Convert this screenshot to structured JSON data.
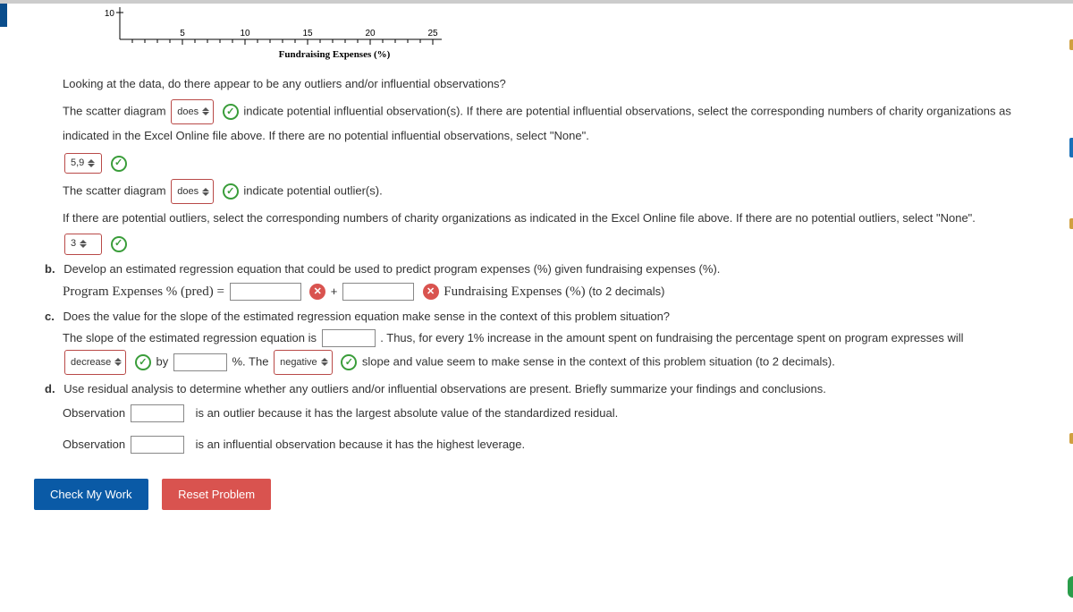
{
  "chart_data": {
    "type": "scatter",
    "xlabel": "Fundraising Expenses (%)",
    "x_ticks": [
      5,
      10,
      15,
      20,
      25
    ],
    "y_tick_visible": 10,
    "xlim": [
      2,
      27
    ]
  },
  "a": {
    "q_outliers": "Looking at the data, do there appear to be any outliers and/or influential observations?",
    "p1_pre": "The scatter diagram",
    "sel_does1": "does",
    "p1_post": "indicate potential influential observation(s). If there are potential influential observations, select the corresponding numbers of charity organizations as indicated in the Excel Online file above. If there are no potential influential observations, select \"None\".",
    "influential_sel": "5,9",
    "p2_pre": "The scatter diagram",
    "sel_does2": "does",
    "p2_post": "indicate potential outlier(s).",
    "p3": "If there are potential outliers, select the corresponding numbers of charity organizations as indicated in the Excel Online file above. If there are no potential outliers, select \"None\".",
    "outlier_sel": "3"
  },
  "b": {
    "label": "b.",
    "prompt": "Develop an estimated regression equation that could be used to predict program expenses (%) given fundraising expenses (%).",
    "lhs": "Program Expenses % (pred) =",
    "plus": "+",
    "rhs_label": "Fundraising Expenses (%)",
    "decimals": "(to 2 decimals)"
  },
  "c": {
    "label": "c.",
    "prompt": "Does the value for the slope of the estimated regression equation make sense in the context of this problem situation?",
    "p1_a": "The slope of the estimated regression equation is",
    "p1_b": ". Thus, for every 1% increase in the amount spent on fundraising the percentage spent on program expresses will",
    "sel_decrease": "decrease",
    "by_word": "by",
    "pct_the": "%. The",
    "sel_negative": "negative",
    "p1_end": "slope and value seem to make sense in the context of this problem situation (to 2 decimals)."
  },
  "d": {
    "label": "d.",
    "prompt": "Use residual analysis to determine whether any outliers and/or influential observations are present. Briefly summarize your findings and conclusions.",
    "obs_word": "Observation",
    "l1_post": "is an outlier because it has the largest absolute value of the standardized residual.",
    "l2_post": "is an influential observation because it has the highest leverage."
  },
  "buttons": {
    "check": "Check My Work",
    "reset": "Reset Problem"
  },
  "icons": {
    "check_glyph": "✓",
    "x_glyph": "✕"
  }
}
